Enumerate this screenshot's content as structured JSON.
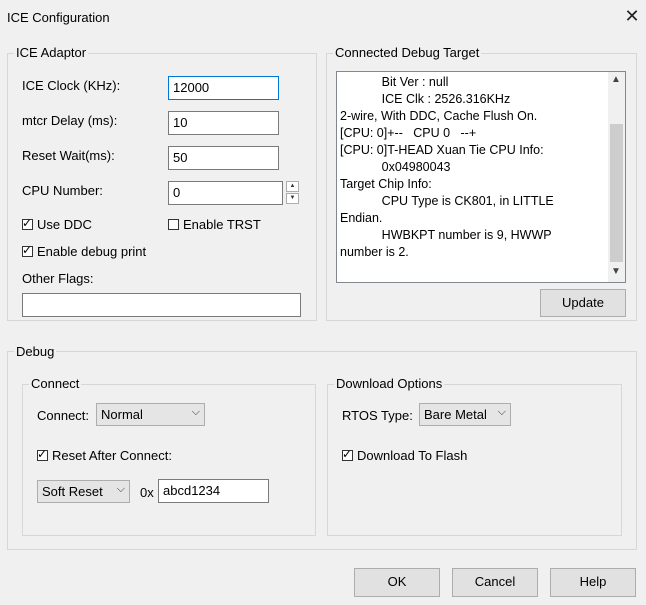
{
  "window": {
    "title": "ICE Configuration"
  },
  "ice_adaptor": {
    "group_label": "ICE Adaptor",
    "clock_label": "ICE Clock (KHz):",
    "clock_value": "12000",
    "mtcr_label": "mtcr Delay (ms):",
    "mtcr_value": "10",
    "reset_wait_label": "Reset Wait(ms):",
    "reset_wait_value": "50",
    "cpu_number_label": "CPU Number:",
    "cpu_number_value": "0",
    "use_ddc_label": "Use DDC",
    "use_ddc_checked": true,
    "enable_trst_label": "Enable TRST",
    "enable_trst_checked": false,
    "debug_print_label": "Enable debug print",
    "debug_print_checked": true,
    "other_flags_label": "Other Flags:",
    "other_flags_value": ""
  },
  "target": {
    "group_label": "Connected Debug Target",
    "lines": [
      "            Bit Ver : null",
      "            ICE Clk : 2526.316KHz",
      "2-wire, With DDC, Cache Flush On.",
      "[CPU: 0]+--   CPU 0   --+",
      "[CPU: 0]T-HEAD Xuan Tie CPU Info:",
      "            0x04980043",
      "Target Chip Info:",
      "            CPU Type is CK801, in LITTLE",
      "Endian.",
      "            HWBKPT number is 9, HWWP",
      "number is 2."
    ],
    "update_label": "Update"
  },
  "debug": {
    "group_label": "Debug",
    "connect": {
      "group_label": "Connect",
      "connect_label": "Connect:",
      "connect_value": "Normal",
      "reset_after_label": "Reset After Connect:",
      "reset_after_checked": true,
      "reset_type_value": "Soft Reset",
      "hex_prefix": "0x",
      "hex_value": "abcd1234"
    },
    "download": {
      "group_label": "Download Options",
      "rtos_label": "RTOS Type:",
      "rtos_value": "Bare Metal",
      "download_flash_label": "Download To Flash",
      "download_flash_checked": true
    }
  },
  "buttons": {
    "ok": "OK",
    "cancel": "Cancel",
    "help": "Help"
  }
}
